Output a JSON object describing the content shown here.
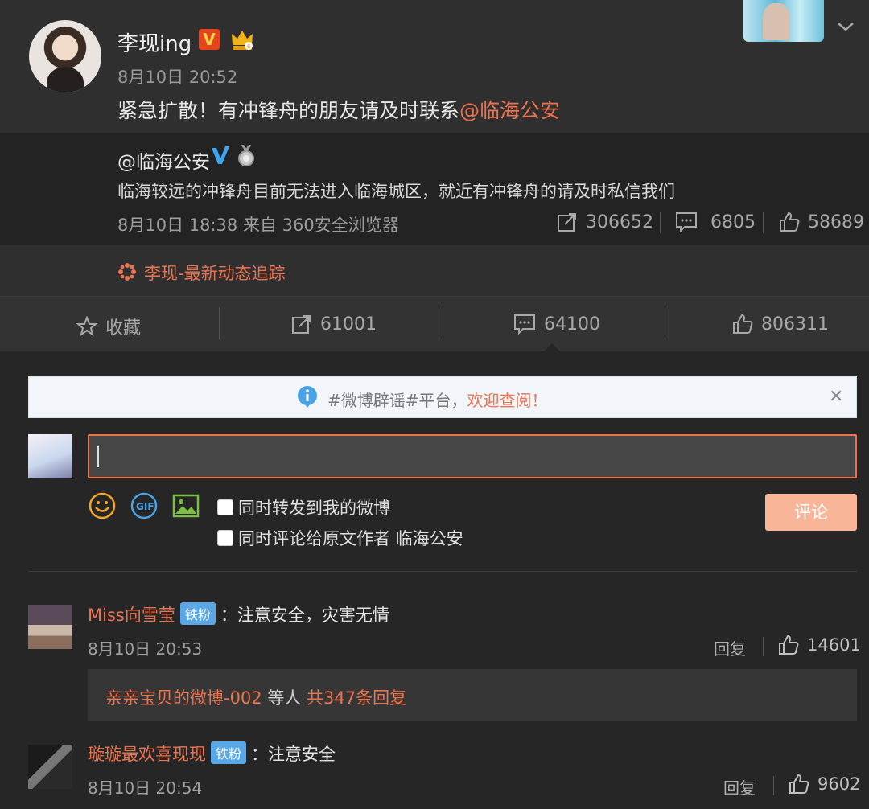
{
  "post": {
    "author": "李现ing",
    "time": "8月10日 20:52",
    "text": "紧急扩散！有冲锋舟的朋友请及时联系",
    "mention": "@临海公安"
  },
  "repost": {
    "author": "@临海公安",
    "text": "临海较远的冲锋舟目前无法进入临海城区，就近有冲锋舟的请及时私信我们",
    "meta": "8月10日 18:38 来自 360安全浏览器",
    "reposts": "306652",
    "comments": "6805",
    "likes": "58689"
  },
  "tracker": {
    "text": "李现-最新动态追踪"
  },
  "actions": {
    "favorite": "收藏",
    "reposts": "61001",
    "comments": "64100",
    "likes": "806311"
  },
  "notice": {
    "prefix": "#微博辟谣#平台，",
    "link": "欢迎查阅！"
  },
  "composer": {
    "check_forward": "同时转发到我的微博",
    "check_comment": "同时评论给原文作者 临海公安",
    "submit": "评论"
  },
  "comments": [
    {
      "name": "Miss向雪莹",
      "badge": "铁粉",
      "text": "：注意安全，灾害无情",
      "time": "8月10日 20:53",
      "reply": "回复",
      "likes": "14601",
      "sub_user": "亲亲宝贝的微博-002",
      "sub_mid": " 等人 ",
      "sub_count": "共347条回复"
    },
    {
      "name": "璇璇最欢喜现现",
      "badge": "铁粉",
      "text": "：注意安全",
      "time": "8月10日 20:54",
      "reply": "回复",
      "likes": "9602"
    }
  ]
}
